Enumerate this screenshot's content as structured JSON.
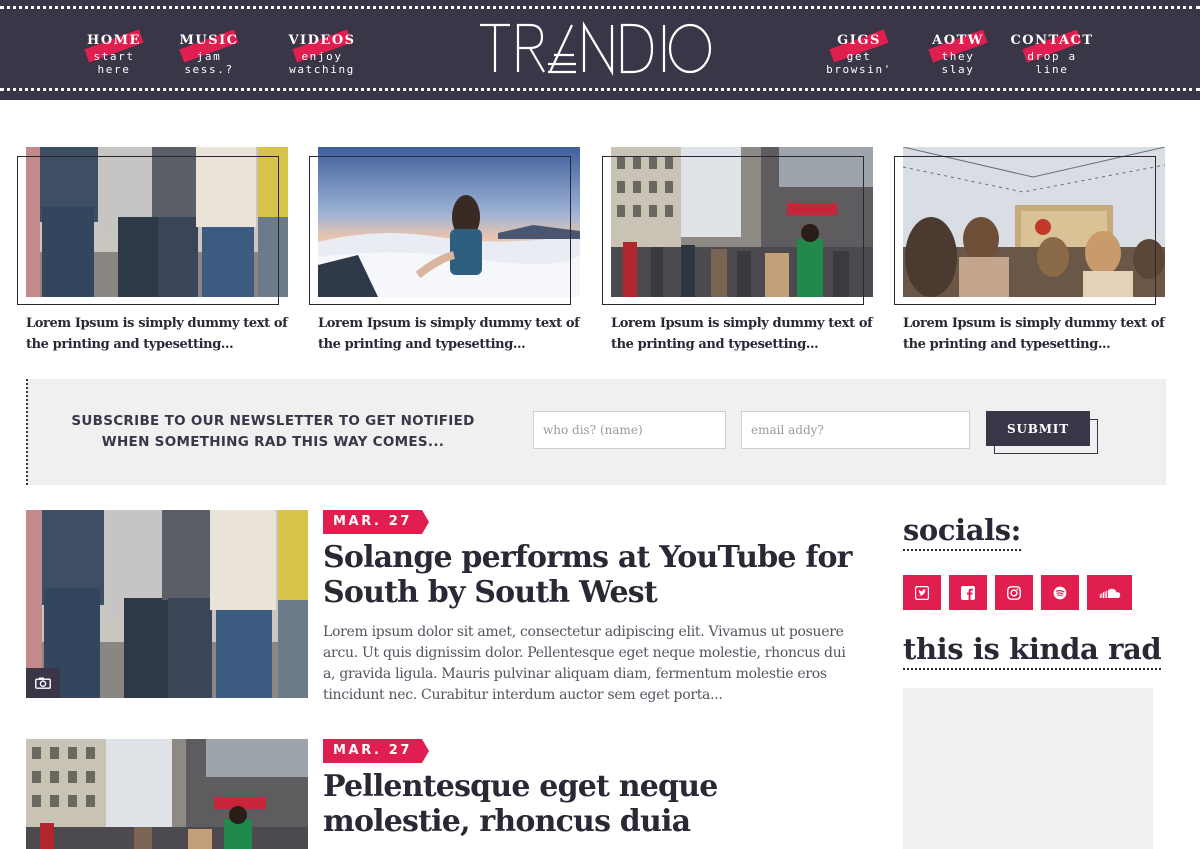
{
  "nav": {
    "left": [
      {
        "label": "HOME",
        "sub": "start here"
      },
      {
        "label": "MUSIC",
        "sub": "jam sess.?"
      },
      {
        "label": "VIDEOS",
        "sub": "enjoy watching"
      }
    ],
    "right": [
      {
        "label": "GIGS",
        "sub": "get browsin'"
      },
      {
        "label": "AOTW",
        "sub": "they slay"
      },
      {
        "label": "CONTACT",
        "sub": "drop a line"
      }
    ]
  },
  "logo": "TRENDIO",
  "featured": [
    {
      "caption": "Lorem Ipsum is simply dummy text of the printing and typesetting..."
    },
    {
      "caption": "Lorem Ipsum is simply dummy text of the printing and typesetting..."
    },
    {
      "caption": "Lorem Ipsum is simply dummy text of the printing and typesetting..."
    },
    {
      "caption": "Lorem Ipsum is simply dummy text of the printing and typesetting..."
    }
  ],
  "newsletter": {
    "text": "SUBSCRIBE TO OUR NEWSLETTER TO GET NOTIFIED WHEN SOMETHING RAD THIS WAY COMES...",
    "name_placeholder": "who dis? (name)",
    "email_placeholder": "email addy?",
    "submit_label": "SUBMIT"
  },
  "articles": [
    {
      "date": "MAR. 27",
      "title": "Solange performs at YouTube for South by South West",
      "excerpt": "Lorem ipsum dolor sit amet, consectetur adipiscing elit. Vivamus ut posuere arcu. Ut quis dignissim dolor. Pellentesque eget neque molestie, rhoncus dui a, gravida ligula. Mauris pulvinar aliquam diam, fermentum molestie eros tincidunt nec. Curabitur interdum auctor sem eget porta..."
    },
    {
      "date": "MAR. 27",
      "title": "Pellentesque eget neque molestie, rhoncus duia"
    }
  ],
  "sidebar": {
    "socials_title": "socials:",
    "social_icons": [
      "twitter-icon",
      "facebook-icon",
      "instagram-icon",
      "spotify-icon",
      "soundcloud-icon"
    ],
    "rad_title": "this is kinda rad"
  },
  "colors": {
    "header_bg": "#3a3547",
    "accent": "#e01e4f",
    "panel_bg": "#f0f0f0"
  }
}
